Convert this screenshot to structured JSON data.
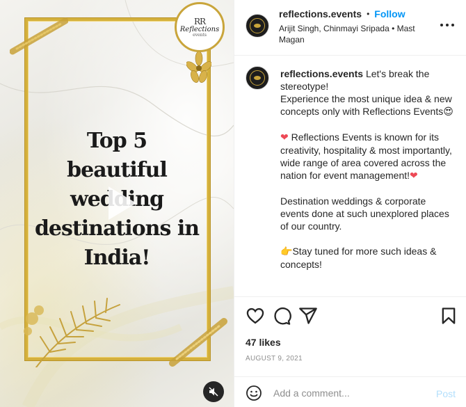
{
  "media": {
    "headline_lines": [
      "Top 5",
      "beautiful wedding",
      "destinations in",
      "India!"
    ],
    "logo": {
      "mark": "RR",
      "name": "Reflections",
      "sub": "events"
    },
    "icons": {
      "play": "play-icon",
      "mute": "mute-icon"
    }
  },
  "header": {
    "username": "reflections.events",
    "separator": "•",
    "follow_label": "Follow",
    "audio_line": "Arijit Singh, Chinmayi Sripada • Mast Magan"
  },
  "caption": {
    "username": "reflections.events",
    "intro": "Let's break the stereotype!",
    "line2": "Experience the most unique idea & new concepts only with Reflections Events",
    "line2_emoji": "😍",
    "para2_emoji": "❤",
    "para2": "Reflections Events is known for its creativity, hospitality & most importantly, wide range of area covered across the nation for event management!",
    "para2_end_emoji": "❤",
    "para3": "Destination weddings & corporate events done at such unexplored places of our country.",
    "para4_emoji": "👉",
    "para4": "Stay tuned for more such ideas & concepts!"
  },
  "actions": {
    "icons": [
      "heart-icon",
      "comment-icon",
      "share-icon",
      "bookmark-icon"
    ]
  },
  "likes": "47 likes",
  "date": "AUGUST 9, 2021",
  "comment": {
    "placeholder": "Add a comment...",
    "post_label": "Post"
  },
  "colors": {
    "follow_blue": "#0095f6",
    "post_disabled": "#b2dffc",
    "gold": "#d4b03c",
    "heart_red": "#ed4956"
  }
}
